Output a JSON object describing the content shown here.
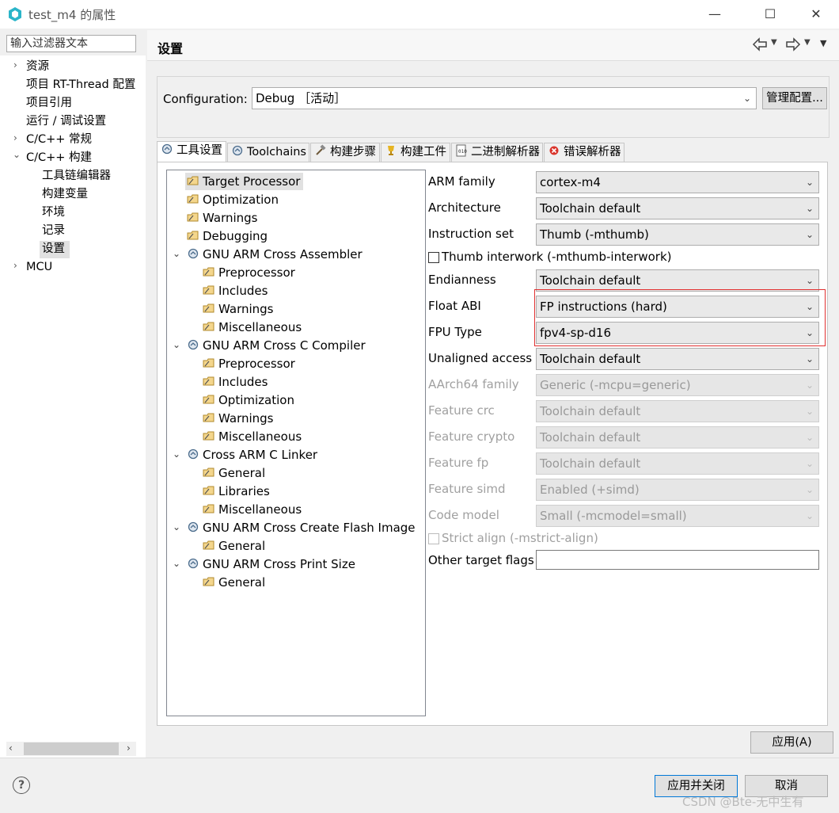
{
  "window": {
    "title": "test_m4 的属性"
  },
  "filter": {
    "placeholder": "输入过滤器文本"
  },
  "sidebar": {
    "items": [
      {
        "label": "资源",
        "expand": "›"
      },
      {
        "label": "项目 RT-Thread 配置"
      },
      {
        "label": "项目引用"
      },
      {
        "label": "运行 / 调试设置"
      },
      {
        "label": "C/C++ 常规",
        "expand": "›"
      },
      {
        "label": "C/C++ 构建",
        "expand": "⌄"
      },
      {
        "label": "工具链编辑器"
      },
      {
        "label": "构建变量"
      },
      {
        "label": "环境"
      },
      {
        "label": "记录"
      },
      {
        "label": "设置"
      },
      {
        "label": "MCU",
        "expand": "›"
      }
    ]
  },
  "header": {
    "title": "设置"
  },
  "config": {
    "label": "Configuration:",
    "value": "Debug ［活动］",
    "manage_label": "管理配置..."
  },
  "tabs": [
    {
      "label": "工具设置",
      "icon": "gear-icon"
    },
    {
      "label": "Toolchains",
      "icon": "gear-icon"
    },
    {
      "label": "构建步骤",
      "icon": "hammer-icon"
    },
    {
      "label": "构建工件",
      "icon": "trophy-icon"
    },
    {
      "label": "二进制解析器",
      "icon": "binary-icon"
    },
    {
      "label": "错误解析器",
      "icon": "error-icon"
    }
  ],
  "tree": [
    {
      "label": "Target Processor"
    },
    {
      "label": "Optimization"
    },
    {
      "label": "Warnings"
    },
    {
      "label": "Debugging"
    },
    {
      "label": "GNU ARM Cross Assembler"
    },
    {
      "label": "Preprocessor"
    },
    {
      "label": "Includes"
    },
    {
      "label": "Warnings"
    },
    {
      "label": "Miscellaneous"
    },
    {
      "label": "GNU ARM Cross C Compiler"
    },
    {
      "label": "Preprocessor"
    },
    {
      "label": "Includes"
    },
    {
      "label": "Optimization"
    },
    {
      "label": "Warnings"
    },
    {
      "label": "Miscellaneous"
    },
    {
      "label": "Cross ARM C Linker"
    },
    {
      "label": "General"
    },
    {
      "label": "Libraries"
    },
    {
      "label": "Miscellaneous"
    },
    {
      "label": "GNU ARM Cross Create Flash Image"
    },
    {
      "label": "General"
    },
    {
      "label": "GNU ARM Cross Print Size"
    },
    {
      "label": "General"
    }
  ],
  "form": {
    "arm_family": {
      "label": "ARM family",
      "value": "cortex-m4"
    },
    "architecture": {
      "label": "Architecture",
      "value": "Toolchain default"
    },
    "instruction_set": {
      "label": "Instruction set",
      "value": "Thumb (-mthumb)"
    },
    "thumb_interwork": {
      "label": "Thumb interwork (-mthumb-interwork)",
      "checked": false
    },
    "endianness": {
      "label": "Endianness",
      "value": "Toolchain default"
    },
    "float_abi": {
      "label": "Float ABI",
      "value": "FP instructions (hard)"
    },
    "fpu_type": {
      "label": "FPU Type",
      "value": "fpv4-sp-d16"
    },
    "unaligned_access": {
      "label": "Unaligned access",
      "value": "Toolchain default"
    },
    "aarch64_family": {
      "label": "AArch64 family",
      "value": "Generic (-mcpu=generic)"
    },
    "feature_crc": {
      "label": "Feature crc",
      "value": "Toolchain default"
    },
    "feature_crypto": {
      "label": "Feature crypto",
      "value": "Toolchain default"
    },
    "feature_fp": {
      "label": "Feature fp",
      "value": "Toolchain default"
    },
    "feature_simd": {
      "label": "Feature simd",
      "value": "Enabled (+simd)"
    },
    "code_model": {
      "label": "Code model",
      "value": "Small (-mcmodel=small)"
    },
    "strict_align": {
      "label": "Strict align (-mstrict-align)",
      "checked": false
    },
    "other_flags": {
      "label": "Other target flags",
      "value": ""
    }
  },
  "buttons": {
    "apply": "应用(A)",
    "apply_close": "应用并关闭",
    "cancel": "取消",
    "help": "?"
  },
  "watermark": "CSDN @Bte-无中生有",
  "colors": {
    "highlight": "#e03030",
    "selection": "#e1e1e1"
  }
}
